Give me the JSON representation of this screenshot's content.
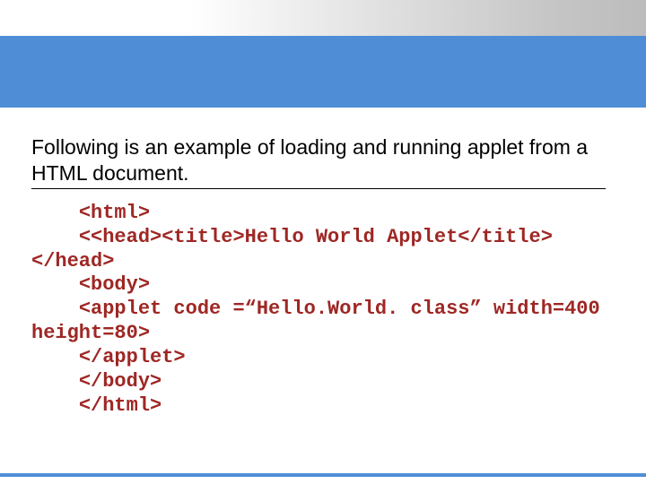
{
  "intro_text": "Following is an example of loading and running applet from a HTML document.",
  "code_text": "    <html>\n    <<head><title>Hello World Applet</title></head>\n    <body>\n    <applet code =“Hello.World. class” width=400 height=80>\n    </applet>\n    </body>\n    </html>"
}
